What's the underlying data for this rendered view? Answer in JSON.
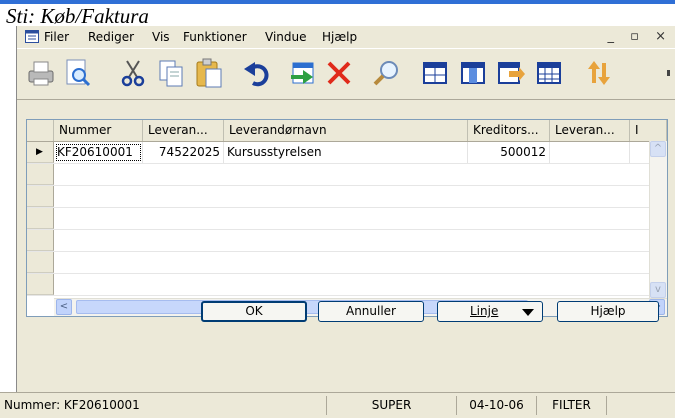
{
  "header": {
    "path_title": "Sti: Køb/Faktura"
  },
  "menu": {
    "items": [
      {
        "label": "Filer"
      },
      {
        "label": "Rediger"
      },
      {
        "label": "Vis"
      },
      {
        "label": "Funktioner"
      },
      {
        "label": "Vindue"
      },
      {
        "label": "Hjælp"
      }
    ],
    "window_controls": {
      "minimize": "_",
      "restore": "▫",
      "close": "×"
    }
  },
  "toolbar": {
    "icons": [
      "print-icon",
      "print-preview-icon",
      "cut-icon",
      "copy-icon",
      "paste-icon",
      "undo-icon",
      "import-icon",
      "delete-icon",
      "find-icon",
      "table-view-icon",
      "columns-icon",
      "list-export-icon",
      "grid-icon",
      "refresh-icon"
    ]
  },
  "grid": {
    "columns": [
      "Nummer",
      "Leveran...",
      "Leverandørnavn",
      "Kreditors...",
      "Leveran...",
      "I"
    ],
    "rows": [
      {
        "nummer": "KF20610001",
        "leveran": "74522025",
        "navn": "Kursusstyrelsen",
        "kreditor": "500012",
        "leveran2": ""
      }
    ],
    "current_row_indicator": "▶",
    "scroll": {
      "left": "<",
      "right": ">",
      "up": "^",
      "down": "v",
      "grip": "|||"
    }
  },
  "buttons": {
    "ok": "OK",
    "cancel": "Annuller",
    "line": "Linje",
    "help": "Hjælp"
  },
  "statusbar": {
    "record": "Nummer: KF20610001",
    "user": "SUPER",
    "date": "04-10-06",
    "filter": "FILTER"
  },
  "colors": {
    "accent": "#2f6fd6",
    "window_bg": "#ece9d8",
    "button_border": "#003c74"
  }
}
